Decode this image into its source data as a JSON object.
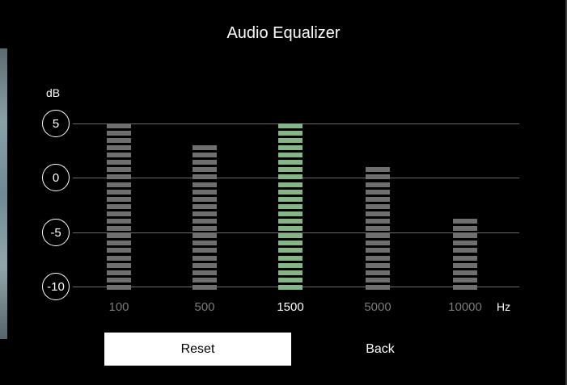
{
  "title": "Audio Equalizer",
  "y_unit": "dB",
  "x_unit": "Hz",
  "db_scale": [
    "5",
    "0",
    "-5",
    "-10"
  ],
  "bands": [
    {
      "freq": "100",
      "gain_db": 5,
      "selected": false
    },
    {
      "freq": "500",
      "gain_db": 3,
      "selected": false
    },
    {
      "freq": "1500",
      "gain_db": 5,
      "selected": true
    },
    {
      "freq": "5000",
      "gain_db": 1,
      "selected": false
    },
    {
      "freq": "10000",
      "gain_db": -4,
      "selected": false
    }
  ],
  "buttons": {
    "reset": "Reset",
    "back": "Back"
  },
  "colors": {
    "bar": "#6f6f6f",
    "bar_selected": "#86b585",
    "label_dim": "#7a7a7a"
  }
}
